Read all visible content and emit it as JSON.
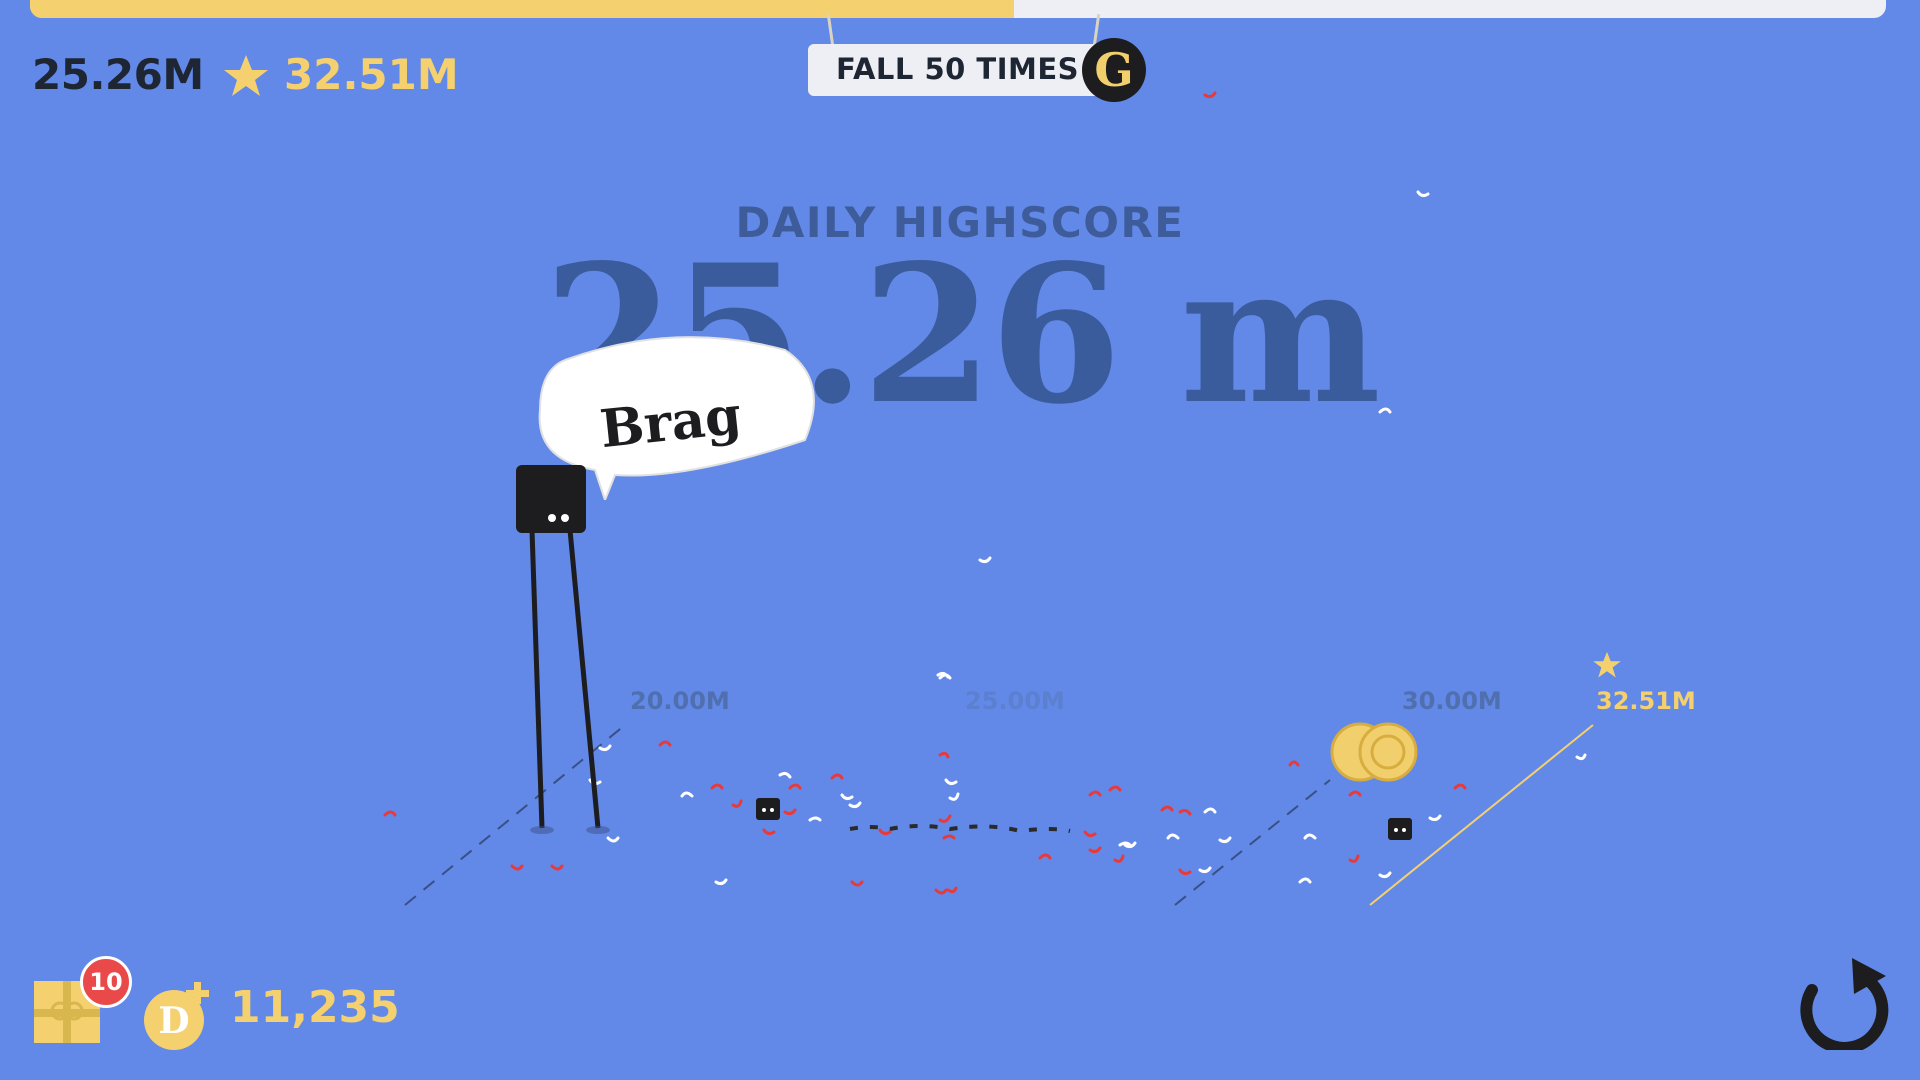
{
  "progress": {
    "fraction": 0.53
  },
  "header": {
    "current_distance": "25.26M",
    "best_distance": "32.51M"
  },
  "goal": {
    "text": "FALL 50 TIMES",
    "badge": "G"
  },
  "highscore": {
    "label": "DAILY HIGHSCORE",
    "value": "25.26 m"
  },
  "brag": {
    "label": "Brag"
  },
  "track": {
    "marker_20": "20.00M",
    "marker_25": "25.00M",
    "marker_30": "30.00M",
    "marker_best": "32.51M"
  },
  "bottom": {
    "gift_count": "10",
    "coin_count": "11,235"
  },
  "colors": {
    "background": "#6289e8",
    "accent_yellow": "#f4d06f",
    "dark": "#1d1d1f",
    "confetti_red": "#e83a3a",
    "confetti_white": "#ffffff"
  },
  "icons": {
    "best": "star-icon",
    "gift": "gift-icon",
    "coin": "coin-plus-icon",
    "retry": "retry-icon"
  }
}
